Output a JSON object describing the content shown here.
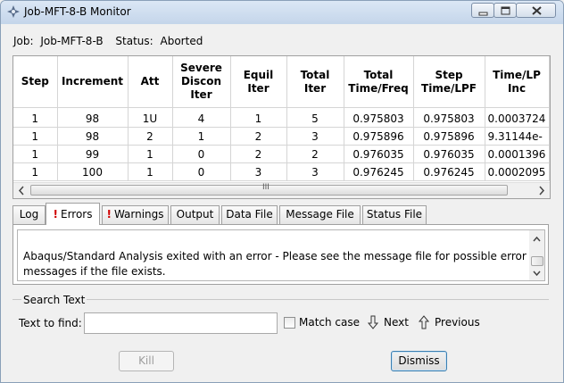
{
  "window": {
    "title": "Job-MFT-8-B Monitor"
  },
  "job": {
    "job_label": "Job:",
    "job_name": "Job-MFT-8-B",
    "status_label": "Status:",
    "status_value": "Aborted"
  },
  "table": {
    "headers": [
      [
        "Step"
      ],
      [
        "Increment"
      ],
      [
        "Att"
      ],
      [
        "Severe",
        "Discon",
        "Iter"
      ],
      [
        "Equil",
        "Iter"
      ],
      [
        "Total",
        "Iter"
      ],
      [
        "Total",
        "Time/Freq"
      ],
      [
        "Step",
        "Time/LPF"
      ],
      [
        "Time/LP",
        "Inc"
      ]
    ],
    "rows": [
      [
        "1",
        "98",
        "1U",
        "4",
        "1",
        "5",
        "0.975803",
        "0.975803",
        "0.0003724"
      ],
      [
        "1",
        "98",
        "2",
        "1",
        "2",
        "3",
        "0.975896",
        "0.975896",
        "9.31144e-"
      ],
      [
        "1",
        "99",
        "1",
        "0",
        "2",
        "2",
        "0.976035",
        "0.976035",
        "0.0001396"
      ],
      [
        "1",
        "100",
        "1",
        "0",
        "3",
        "3",
        "0.976245",
        "0.976245",
        "0.0002095"
      ]
    ],
    "scroll_grip": "III"
  },
  "tabs": [
    {
      "label": "Log",
      "error": false
    },
    {
      "label": "Errors",
      "error": true,
      "active": true
    },
    {
      "label": "Warnings",
      "error": true
    },
    {
      "label": "Output",
      "error": false
    },
    {
      "label": "Data File",
      "error": false
    },
    {
      "label": "Message File",
      "error": false
    },
    {
      "label": "Status File",
      "error": false
    }
  ],
  "error_marker": "!",
  "errors_text": "Abaqus/Standard Analysis exited with an error - Please see the  message file for possible error messages if the file exists.",
  "search": {
    "group_title": "Search Text",
    "find_label": "Text to find:",
    "find_value": "",
    "match_case_label": "Match case",
    "match_case_checked": false,
    "next_label": "Next",
    "previous_label": "Previous"
  },
  "buttons": {
    "kill_label": "Kill",
    "dismiss_label": "Dismiss"
  },
  "colors": {
    "error_red": "#d00000",
    "title_bar": "#c4d5ea"
  }
}
